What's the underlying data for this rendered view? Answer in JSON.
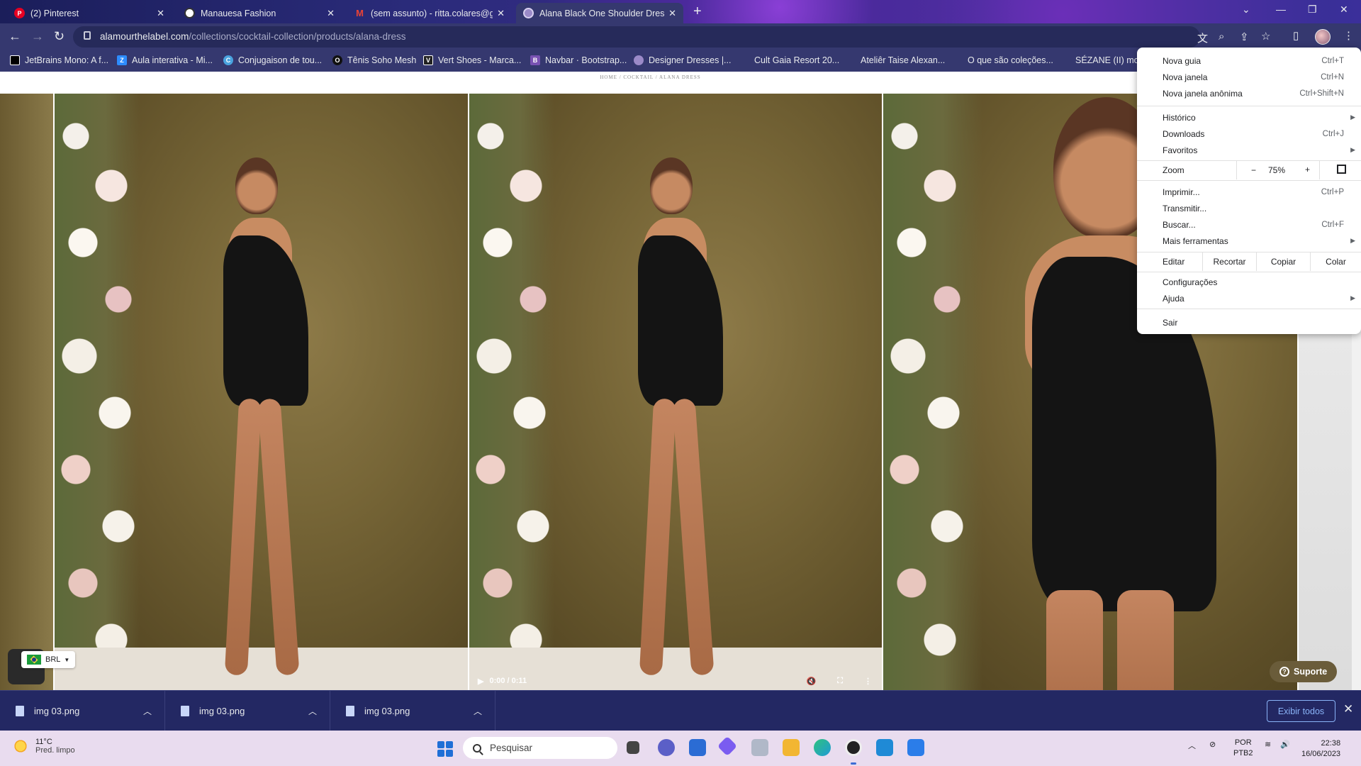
{
  "tabs": [
    {
      "title": "(2) Pinterest",
      "icon": "pinterest-icon",
      "color": "#e60023",
      "glyph": "P",
      "active": false
    },
    {
      "title": "Manauesa Fashion",
      "icon": "globe-icon",
      "color": "#ffffff",
      "glyph": "",
      "active": false
    },
    {
      "title": "(sem assunto) - ritta.colares@gm",
      "icon": "gmail-icon",
      "color": "#ea4335",
      "glyph": "M",
      "active": false
    },
    {
      "title": "Alana Black One Shoulder Dress",
      "icon": "site-icon",
      "color": "#9b8ac8",
      "glyph": "",
      "active": true
    }
  ],
  "address": {
    "domain": "alamourthelabel.com",
    "path": "/collections/cocktail-collection/products/alana-dress"
  },
  "bookmarks": [
    {
      "label": "JetBrains Mono: A f...",
      "icon": "jetbrains-icon",
      "color": "#000000",
      "glyph": ""
    },
    {
      "label": "Aula interativa - Mi...",
      "icon": "zoom-z-icon",
      "color": "#2d8cff",
      "glyph": "Z"
    },
    {
      "label": "Conjugaison de tou...",
      "icon": "conjugation-icon",
      "color": "#4aa3df",
      "glyph": "C"
    },
    {
      "label": "Tênis Soho Mesh",
      "icon": "brand-icon",
      "color": "#111111",
      "glyph": "O"
    },
    {
      "label": "Vert Shoes - Marca...",
      "icon": "vert-icon",
      "color": "#222222",
      "glyph": "V"
    },
    {
      "label": "Navbar · Bootstrap...",
      "icon": "bootstrap-icon",
      "color": "#7952b3",
      "glyph": "B"
    },
    {
      "label": "Designer Dresses |...",
      "icon": "site-icon",
      "color": "#9b8ac8",
      "glyph": ""
    },
    {
      "label": "Cult Gaia Resort 20...",
      "icon": "",
      "color": "",
      "glyph": ""
    },
    {
      "label": "Ateliêr Taise Alexan...",
      "icon": "",
      "color": "",
      "glyph": ""
    },
    {
      "label": "O que são coleções...",
      "icon": "",
      "color": "",
      "glyph": ""
    },
    {
      "label": "SÉZANE (II) mod",
      "icon": "",
      "color": "",
      "glyph": ""
    }
  ],
  "page": {
    "breadcrumb": "HOME / COCKTAIL / ALANA DRESS",
    "video_time": "0:00 / 0:11",
    "currency": "BRL",
    "support_label": "Suporte"
  },
  "menu": {
    "items_top": [
      {
        "label": "Nova guia",
        "shortcut": "Ctrl+T"
      },
      {
        "label": "Nova janela",
        "shortcut": "Ctrl+N"
      },
      {
        "label": "Nova janela anônima",
        "shortcut": "Ctrl+Shift+N"
      }
    ],
    "items_mid": [
      {
        "label": "Histórico",
        "shortcut": "",
        "submenu": true
      },
      {
        "label": "Downloads",
        "shortcut": "Ctrl+J",
        "submenu": false
      },
      {
        "label": "Favoritos",
        "shortcut": "",
        "submenu": true
      }
    ],
    "zoom": {
      "label": "Zoom",
      "minus": "−",
      "value": "75%",
      "plus": "+"
    },
    "items_tools": [
      {
        "label": "Imprimir...",
        "shortcut": "Ctrl+P",
        "submenu": false
      },
      {
        "label": "Transmitir...",
        "shortcut": "",
        "submenu": false
      },
      {
        "label": "Buscar...",
        "shortcut": "Ctrl+F",
        "submenu": false
      },
      {
        "label": "Mais ferramentas",
        "shortcut": "",
        "submenu": true
      }
    ],
    "edit": {
      "label": "Editar",
      "cut": "Recortar",
      "copy": "Copiar",
      "paste": "Colar"
    },
    "items_bottom": [
      {
        "label": "Configurações",
        "submenu": false
      },
      {
        "label": "Ajuda",
        "submenu": true
      }
    ],
    "exit": "Sair"
  },
  "downloads": {
    "items": [
      "img 03.png",
      "img 03.png",
      "img 03.png"
    ],
    "show_all": "Exibir todos"
  },
  "taskbar": {
    "temperature": "11°C",
    "weather": "Pred. limpo",
    "search_placeholder": "Pesquisar",
    "apps": [
      {
        "name": "task-view-icon",
        "color": "#444444",
        "glyph": ""
      },
      {
        "name": "chat-icon",
        "color": "#5b5fc7",
        "glyph": ""
      },
      {
        "name": "store-icon",
        "color": "#2b6cd4",
        "glyph": ""
      },
      {
        "name": "copilot-icon",
        "color": "#7a5cf0",
        "glyph": ""
      },
      {
        "name": "cloud-icon",
        "color": "#b0b8c8",
        "glyph": ""
      },
      {
        "name": "file-explorer-icon",
        "color": "#f2b632",
        "glyph": ""
      },
      {
        "name": "edge-icon",
        "color": "#1f9ad6",
        "glyph": ""
      },
      {
        "name": "chrome-icon",
        "color": "#222222",
        "glyph": ""
      },
      {
        "name": "vscode-icon",
        "color": "#1f8ad6",
        "glyph": ""
      },
      {
        "name": "paint-icon",
        "color": "#2b7de9",
        "glyph": ""
      }
    ],
    "lang": "POR",
    "layout": "PTB2",
    "time": "22:38",
    "date": "16/06/2023"
  }
}
